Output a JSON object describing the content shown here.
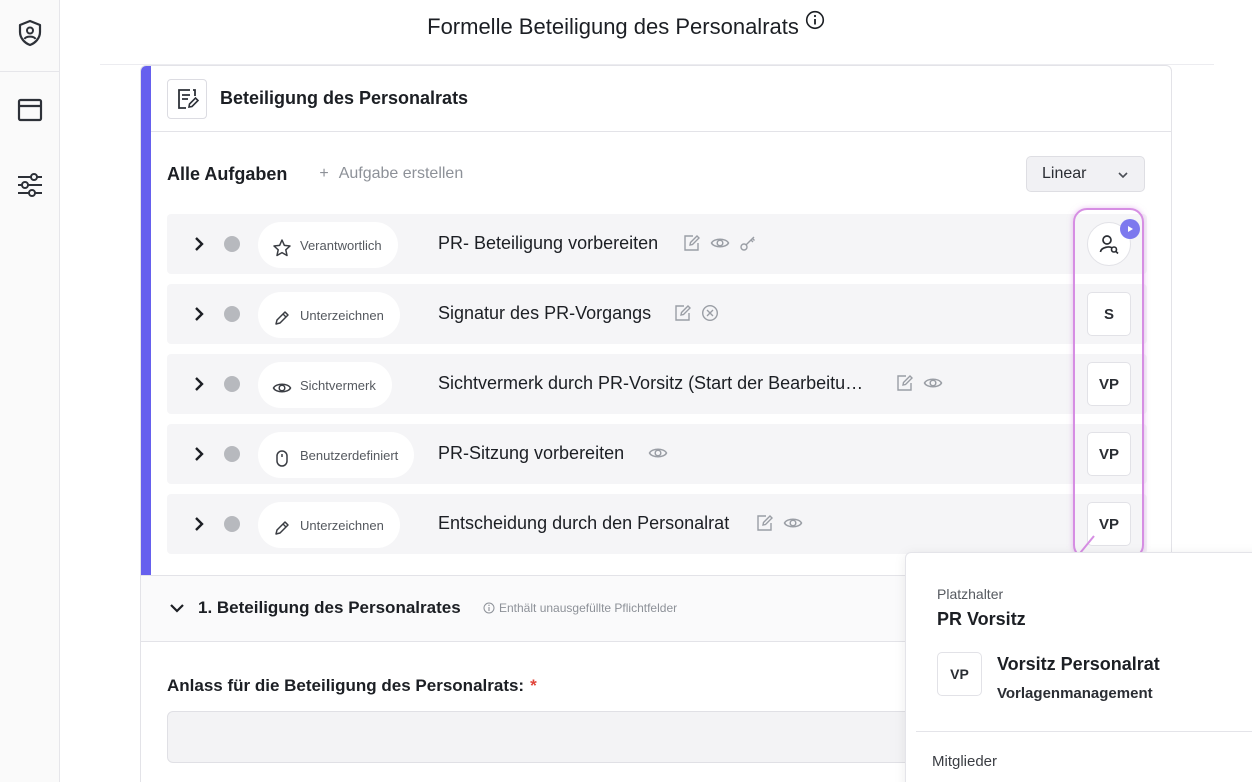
{
  "page": {
    "title": "Formelle Beteiligung des Personalrats"
  },
  "sidebar": {
    "icons": [
      "shield-user-icon",
      "window-icon",
      "sliders-icon"
    ]
  },
  "card": {
    "title": "Beteiligung des Personalrats",
    "tasks_title": "Alle Aufgaben",
    "add_task_label": "Aufgabe erstellen",
    "view_select": "Linear"
  },
  "tasks": [
    {
      "type": "Verantwortlich",
      "type_icon": "star-icon",
      "title": "PR- Beteiligung vorbereiten",
      "icons": [
        "edit-icon",
        "eye-icon",
        "key-icon"
      ],
      "assignee": ""
    },
    {
      "type": "Unterzeichnen",
      "type_icon": "pen-icon",
      "title": "Signatur des PR-Vorgangs",
      "icons": [
        "edit-icon",
        "cancel-circle-icon"
      ],
      "assignee": "S"
    },
    {
      "type": "Sichtvermerk",
      "type_icon": "eye-icon",
      "title": "Sichtvermerk durch PR-Vorsitz (Start der Bearbeitu…",
      "icons": [
        "edit-icon",
        "eye-icon"
      ],
      "assignee": "VP"
    },
    {
      "type": "Benutzerdefiniert",
      "type_icon": "mouse-icon",
      "title": "PR-Sitzung vorbereiten",
      "icons": [
        "eye-icon"
      ],
      "assignee": "VP"
    },
    {
      "type": "Unterzeichnen",
      "type_icon": "pen-icon",
      "title": "Entscheidung durch den Personalrat",
      "icons": [
        "edit-icon",
        "eye-icon"
      ],
      "assignee": "VP"
    }
  ],
  "section": {
    "title": "1. Beteiligung des Personalrates",
    "warning": "Enthält unausgefüllte Pflichtfelder"
  },
  "form": {
    "field_label": "Anlass für die Beteiligung des Personalrats:",
    "required_mark": "*",
    "field_value": ""
  },
  "popover": {
    "label": "Platzhalter",
    "role": "PR Vorsitz",
    "avatar": "VP",
    "name": "Vorsitz Personalrat",
    "group": "Vorlagenmanagement",
    "members_label": "Mitglieder"
  },
  "colors": {
    "accent": "#6660ee",
    "highlight": "#d68ee3",
    "required": "#e0443a"
  }
}
